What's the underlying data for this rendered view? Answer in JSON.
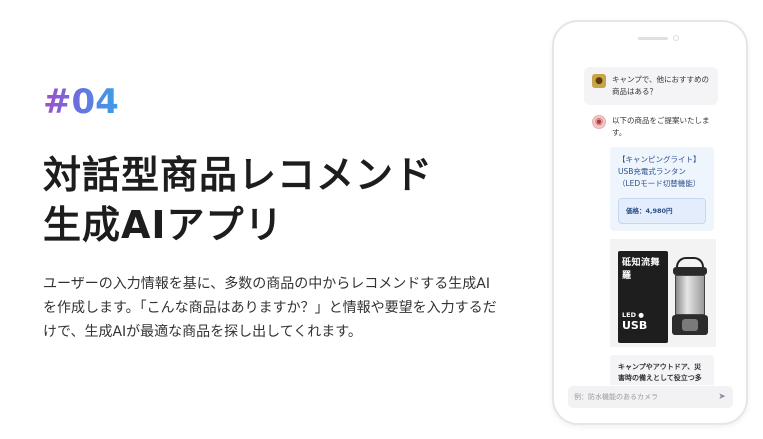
{
  "hero": {
    "number": "#04",
    "title_line1": "対話型商品レコメンド",
    "title_line2": "生成AIアプリ",
    "description": "ユーザーの入力情報を基に、多数の商品の中からレコメンドする生成AIを作成します。「こんな商品はありますか？」と情報や要望を入力するだけで、生成AIが最適な商品を探し出してくれます。"
  },
  "phone": {
    "user_message": "キャンプで、他におすすめの商品はある？",
    "bot_message": "以下の商品をご提案いたします。",
    "product": {
      "name": "【キャンピングライト】USB充電式ランタン（LEDモード切替機能）",
      "price": "価格：4,980円",
      "image_title": "砥知流舞羅",
      "image_sub": "LED ●",
      "image_sub2": "USB"
    },
    "product_description": "キャンプやアウトドア、災害時の備えとして役立つ多",
    "input_placeholder": "例：防水機能のあるカメラ",
    "icons": {
      "user_avatar": "dog-avatar-icon",
      "bot_avatar": "robot-avatar-icon",
      "send": "send-icon"
    }
  },
  "colors": {
    "number_gradient": [
      "#a04ec9",
      "#6b6fe0",
      "#3aa0e8"
    ],
    "card_bg": "#eef5fd",
    "card_text": "#2b4f8c"
  }
}
